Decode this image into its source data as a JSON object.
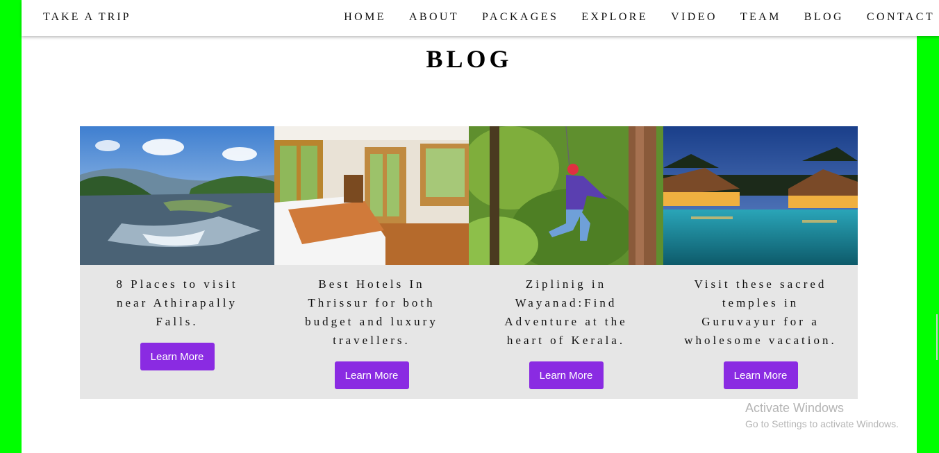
{
  "brand": "TAKE A TRIP",
  "nav": [
    "HOME",
    "ABOUT",
    "PACKAGES",
    "EXPLORE",
    "VIDEO",
    "TEAM",
    "BLOG",
    "CONTACT"
  ],
  "section_title": "BLOG",
  "cards": [
    {
      "image": "river-photo",
      "text": "8 Places to visit near Athirapally Falls.",
      "button": "Learn More"
    },
    {
      "image": "hotel-room-photo",
      "text": "Best Hotels In Thrissur for both budget and luxury travellers.",
      "button": "Learn More"
    },
    {
      "image": "zipline-photo",
      "text": "Ziplinig in Wayanad:Find Adventure at the heart of Kerala.",
      "button": "Learn More"
    },
    {
      "image": "resort-pool-photo",
      "text": "Visit these sacred temples in Guruvayur for a wholesome vacation.",
      "button": "Learn More"
    }
  ],
  "watermark": {
    "title": "Activate Windows",
    "subtitle": "Go to Settings to activate Windows."
  },
  "colors": {
    "side_bars": "#00ff00",
    "button": "#8a2be2",
    "card_bg": "#e6e6e6"
  }
}
